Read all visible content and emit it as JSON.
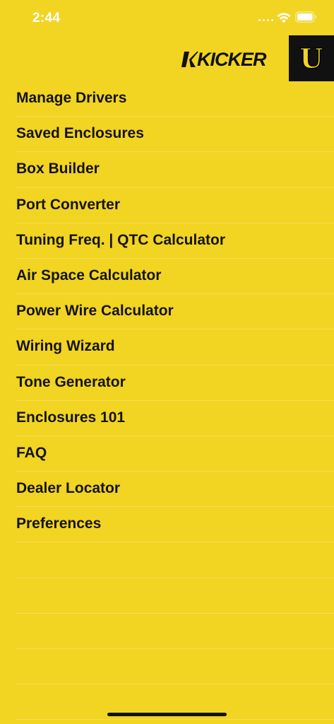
{
  "status_bar": {
    "time": "2:44",
    "icons": [
      "signal-dots-icon",
      "wifi-icon",
      "battery-icon"
    ]
  },
  "header": {
    "brand_logo_text": "KICKER",
    "badge_letter": "U"
  },
  "menu": {
    "items": [
      {
        "label": "Manage Drivers"
      },
      {
        "label": "Saved Enclosures"
      },
      {
        "label": "Box Builder"
      },
      {
        "label": "Port Converter"
      },
      {
        "label": "Tuning Freq. | QTC Calculator"
      },
      {
        "label": "Air Space Calculator"
      },
      {
        "label": "Power Wire Calculator"
      },
      {
        "label": "Wiring Wizard"
      },
      {
        "label": "Tone Generator"
      },
      {
        "label": "Enclosures 101"
      },
      {
        "label": "FAQ"
      },
      {
        "label": "Dealer Locator"
      },
      {
        "label": "Preferences"
      }
    ]
  },
  "colors": {
    "background": "#F2D422",
    "text": "#141414",
    "badge_background": "#111111",
    "status_text": "#FFFFFF"
  }
}
